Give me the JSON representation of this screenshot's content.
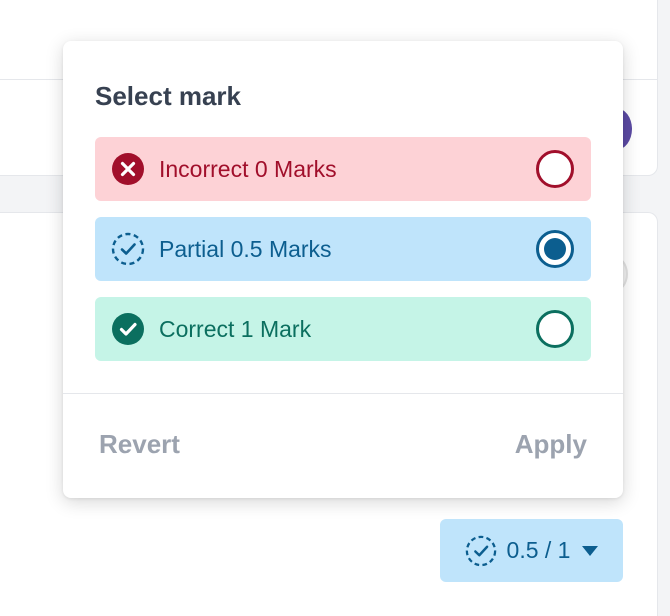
{
  "popover": {
    "title": "Select mark",
    "options": [
      {
        "label": "Incorrect 0 Marks",
        "icon": "x-circle-icon",
        "selected": false,
        "color": "#a10f2b",
        "background": "#fdd2d6"
      },
      {
        "label": "Partial 0.5 Marks",
        "icon": "dashed-check-circle-icon",
        "selected": true,
        "color": "#0c5e8f",
        "background": "#bfe4fb"
      },
      {
        "label": "Correct 1 Mark",
        "icon": "check-circle-icon",
        "selected": false,
        "color": "#0b6f5f",
        "background": "#c5f4e7"
      }
    ],
    "revert_label": "Revert",
    "apply_label": "Apply"
  },
  "score_chip": {
    "text": "0.5 / 1",
    "icon": "dashed-check-circle-icon"
  }
}
